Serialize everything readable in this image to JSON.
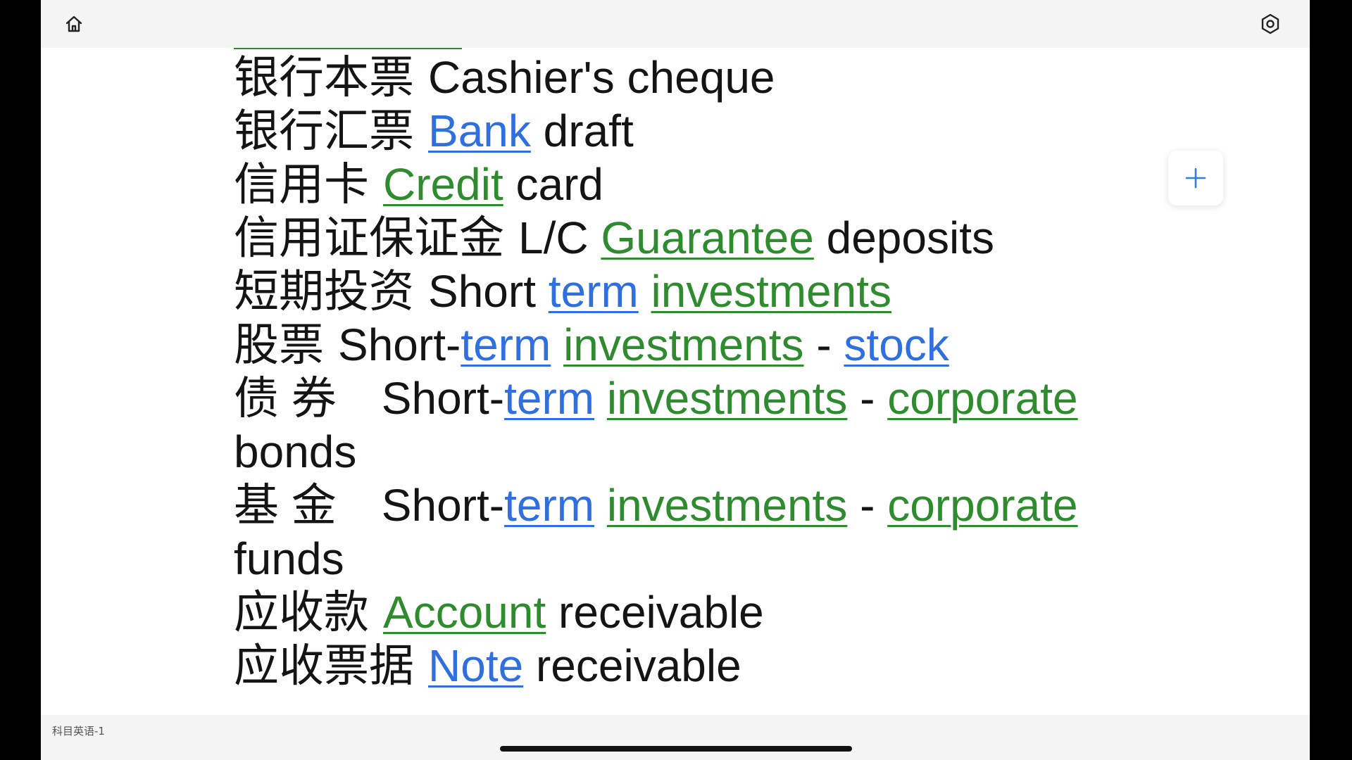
{
  "document": {
    "label": "科目英语-1"
  },
  "colors": {
    "link_blue": "#2f6fe0",
    "link_green": "#2e8b2e",
    "text": "#141414"
  },
  "icons": {
    "home": "home-icon",
    "settings": "settings-icon",
    "add": "plus-icon"
  },
  "entries": [
    {
      "cn": "银行本票",
      "parts": [
        {
          "t": "Cashier's cheque"
        }
      ]
    },
    {
      "cn": "银行汇票",
      "parts": [
        {
          "t": "Bank",
          "link": "blue"
        },
        {
          "t": " draft"
        }
      ]
    },
    {
      "cn": "信用卡",
      "parts": [
        {
          "t": "Credit",
          "link": "green"
        },
        {
          "t": " card"
        }
      ]
    },
    {
      "cn": "信用证保证金",
      "parts": [
        {
          "t": "L/C "
        },
        {
          "t": "Guarantee",
          "link": "green"
        },
        {
          "t": " deposits"
        }
      ]
    },
    {
      "cn": "短期投资",
      "parts": [
        {
          "t": "Short "
        },
        {
          "t": "term",
          "link": "blue"
        },
        {
          "t": " "
        },
        {
          "t": "investments",
          "link": "green"
        }
      ]
    },
    {
      "cn": "股票",
      "parts": [
        {
          "t": "Short-"
        },
        {
          "t": "term",
          "link": "blue"
        },
        {
          "t": " "
        },
        {
          "t": "investments",
          "link": "green"
        },
        {
          "t": " - "
        },
        {
          "t": "stock",
          "link": "blue"
        }
      ]
    },
    {
      "cn": "债 券",
      "parts": [
        {
          "t": "Short-"
        },
        {
          "t": "term",
          "link": "blue"
        },
        {
          "t": " "
        },
        {
          "t": "investments",
          "link": "green"
        },
        {
          "t": " - "
        },
        {
          "t": "corporate",
          "link": "green"
        }
      ],
      "wrap": "bonds"
    },
    {
      "cn": "基 金",
      "parts": [
        {
          "t": "Short-"
        },
        {
          "t": "term",
          "link": "blue"
        },
        {
          "t": " "
        },
        {
          "t": "investments",
          "link": "green"
        },
        {
          "t": " - "
        },
        {
          "t": "corporate",
          "link": "green"
        }
      ],
      "wrap": "funds"
    },
    {
      "cn": "应收款",
      "parts": [
        {
          "t": "Account",
          "link": "green"
        },
        {
          "t": " receivable"
        }
      ]
    },
    {
      "cn": "应收票据",
      "parts": [
        {
          "t": "Note",
          "link": "blue"
        },
        {
          "t": " receivable"
        }
      ]
    }
  ]
}
